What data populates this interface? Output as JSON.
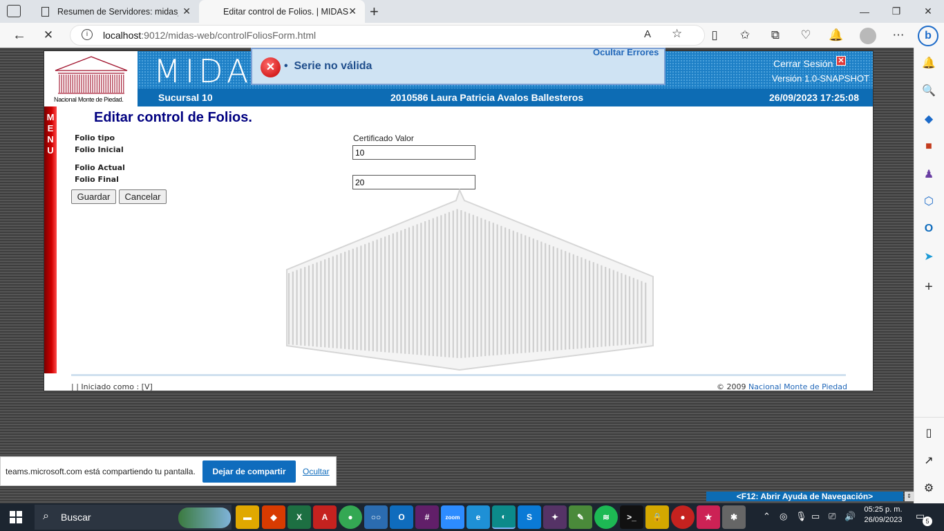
{
  "browser": {
    "tabs": [
      {
        "label": "Resumen de Servidores: midas_d"
      },
      {
        "label": "Editar control de Folios. | MIDAS"
      }
    ],
    "url": {
      "host": "localhost",
      "rest": ":9012/midas-web/controlFoliosForm.html"
    }
  },
  "app": {
    "header_brand": "MIDAS",
    "logo_caption": "Nacional Monte de Piedad.",
    "hide_errors": "Ocultar Errores",
    "error_message": "Serie no válida",
    "logout": "Cerrar Sesión",
    "version": "Versión 1.0-SNAPSHOT",
    "branch": "Sucursal 10",
    "user": "2010586 Laura Patricia Avalos Ballesteros",
    "datetime": "26/09/2023 17:25:08",
    "menu_letters": [
      "M",
      "E",
      "N",
      "U"
    ],
    "page_title": "Editar control de Folios.",
    "form": {
      "folio_tipo_label": "Folio tipo",
      "folio_tipo_value": "Certificado Valor",
      "folio_inicial_label": "Folio Inicial",
      "folio_inicial_value": "10",
      "folio_actual_label": "Folio Actual",
      "folio_final_label": "Folio Final",
      "folio_final_value": "20",
      "save": "Guardar",
      "cancel": "Cancelar"
    },
    "footer_left": "| | Iniciado como : [V]",
    "footer_copy": "© 2009",
    "footer_link": "Nacional Monte de Piedad",
    "help_bar": "<F12: Abrir Ayuda de Navegación>"
  },
  "share_bar": {
    "message": "teams.microsoft.com está compartiendo tu pantalla.",
    "stop": "Dejar de compartir",
    "hide": "Ocultar"
  },
  "taskbar": {
    "search": "Buscar",
    "time": "05:25 p. m.",
    "date": "26/09/2023",
    "notifications": "5"
  },
  "colors": {
    "header_blue": "#1d7fc6",
    "menu_red": "#d10000",
    "title_navy": "#000080"
  }
}
